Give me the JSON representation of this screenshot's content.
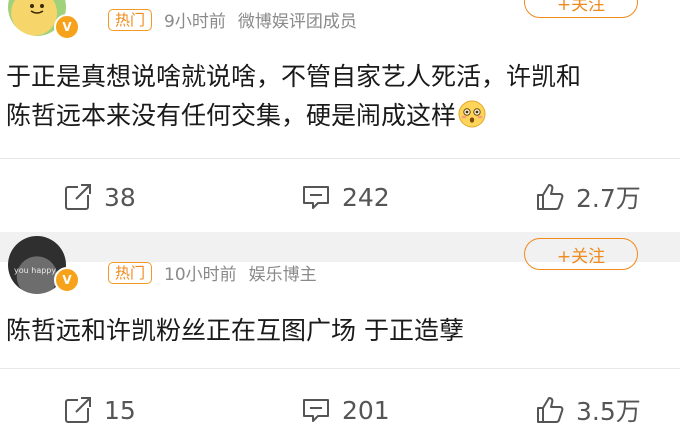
{
  "posts": [
    {
      "avatar_badge": "V",
      "hot_label": "热门",
      "time": "9小时前",
      "source": "微博娱评团成员",
      "follow_label": "+关注",
      "text_line1": "于正是真想说啥就说啥，不管自家艺人死活，许凯和",
      "text_line2": "陈哲远本来没有任何交集，硬是闹成这样",
      "emoji": "flushed-face-emoji",
      "reposts": "38",
      "comments": "242",
      "likes": "2.7万"
    },
    {
      "avatar_badge": "V",
      "avatar_text": "you happy",
      "hot_label": "热门",
      "time": "10小时前",
      "source": "娱乐博主",
      "follow_label": "+关注",
      "text_line1": "陈哲远和许凯粉丝正在互图广场 于正造孽",
      "reposts": "15",
      "comments": "201",
      "likes": "3.5万"
    }
  ],
  "icons": {
    "repost": "repost-icon",
    "comment": "comment-icon",
    "like": "like-icon"
  },
  "colors": {
    "accent": "#f08a1c",
    "meta_gray": "#8a8a8a",
    "divider": "#e8e8e8",
    "verified": "#f7a21b"
  }
}
